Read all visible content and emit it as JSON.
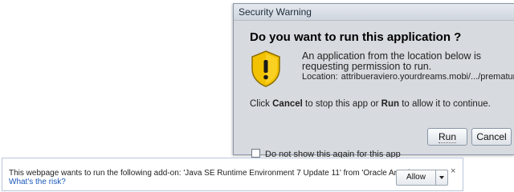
{
  "dialog": {
    "title": "Security Warning",
    "heading": "Do you want to run this application ?",
    "message": "An application from the location below is requesting permission to run.",
    "location_label": "Location:",
    "location_value": "attribueraviero.yourdreams.mobi/.../premature_...",
    "instruction_parts": [
      "Click ",
      "Cancel",
      " to stop this app or ",
      "Run",
      " to allow it to continue."
    ],
    "run_label": "Run",
    "cancel_label": "Cancel",
    "checkbox_label": "Do not show this again for this app",
    "checkbox_checked": false,
    "shield_icon": "warning-shield-icon",
    "shield_color": "#f2c200"
  },
  "notification_bar": {
    "message": "This webpage wants to run the following add-on: 'Java SE Runtime Environment 7 Update 11' from 'Oracle America, Inc.'.",
    "link_text": "What's the risk?",
    "allow_label": "Allow",
    "dropdown_icon": "chevron-down-icon",
    "close_icon": "close-icon",
    "close_glyph": "×",
    "link_color": "#1a56b8"
  }
}
